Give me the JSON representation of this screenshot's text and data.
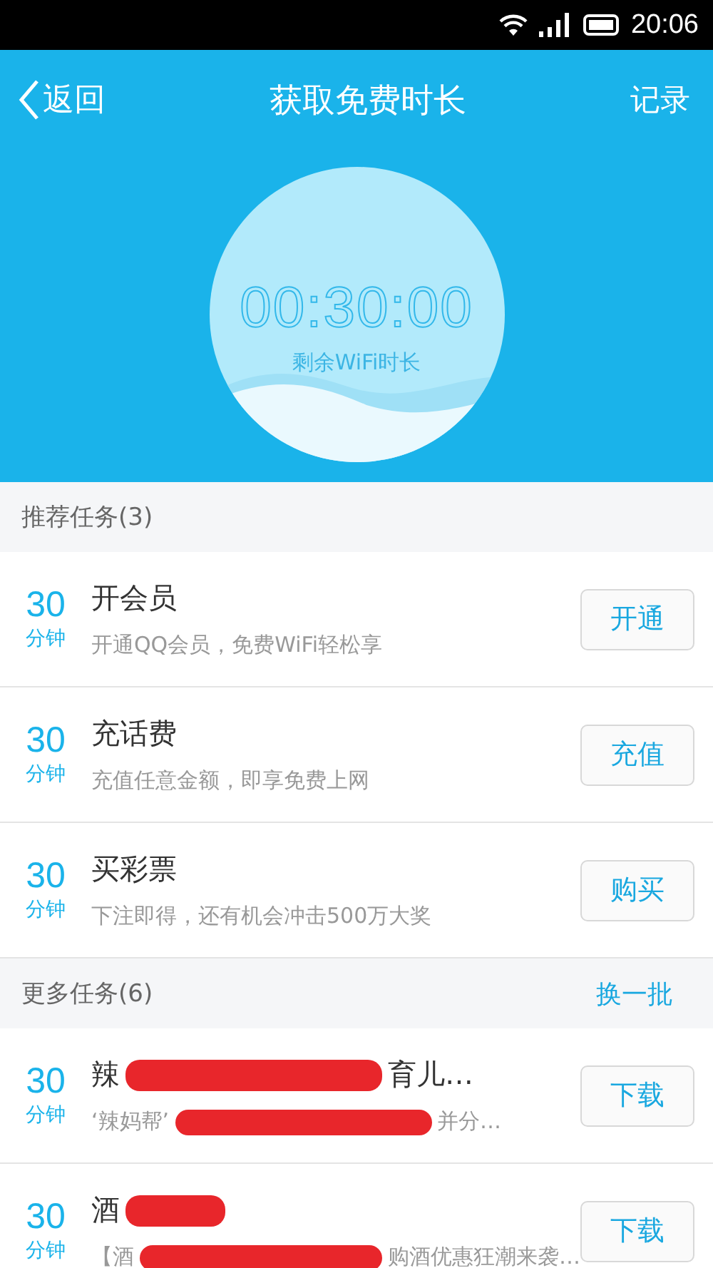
{
  "status_bar": {
    "time": "20:06"
  },
  "nav": {
    "back": "返回",
    "title": "获取免费时长",
    "action": "记录"
  },
  "timer": {
    "time": "00:30:00",
    "caption": "剩余WiFi时长"
  },
  "sections": [
    {
      "title": "推荐任务(3)",
      "tasks": [
        {
          "amount": "30",
          "unit": "分钟",
          "title": [
            {
              "kind": "text",
              "text": "开会员"
            }
          ],
          "desc": [
            {
              "kind": "text",
              "text": "开通QQ会员，免费WiFi轻松享"
            }
          ],
          "button": "开通"
        },
        {
          "amount": "30",
          "unit": "分钟",
          "title": [
            {
              "kind": "text",
              "text": "充话费"
            }
          ],
          "desc": [
            {
              "kind": "text",
              "text": "充值任意金额，即享免费上网"
            }
          ],
          "button": "充值"
        },
        {
          "amount": "30",
          "unit": "分钟",
          "title": [
            {
              "kind": "text",
              "text": "买彩票"
            }
          ],
          "desc": [
            {
              "kind": "text",
              "text": "下注即得，还有机会冲击500万大奖"
            }
          ],
          "button": "购买"
        }
      ]
    },
    {
      "title": "更多任务(6)",
      "action": "换一批",
      "tasks": [
        {
          "amount": "30",
          "unit": "分钟",
          "title": [
            {
              "kind": "text",
              "text": "辣"
            },
            {
              "kind": "redacted"
            },
            {
              "kind": "text",
              "text": "育儿…"
            }
          ],
          "desc": [
            {
              "kind": "text",
              "text": "‘辣妈帮’"
            },
            {
              "kind": "redacted"
            },
            {
              "kind": "text",
              "text": "并分…"
            }
          ],
          "button": "下载"
        },
        {
          "amount": "30",
          "unit": "分钟",
          "title": [
            {
              "kind": "text",
              "text": "酒"
            },
            {
              "kind": "redacted"
            }
          ],
          "desc": [
            {
              "kind": "text",
              "text": "【酒"
            },
            {
              "kind": "redacted"
            },
            {
              "kind": "text",
              "text": "购酒优惠狂潮来袭…"
            }
          ],
          "button": "下载"
        }
      ]
    }
  ]
}
